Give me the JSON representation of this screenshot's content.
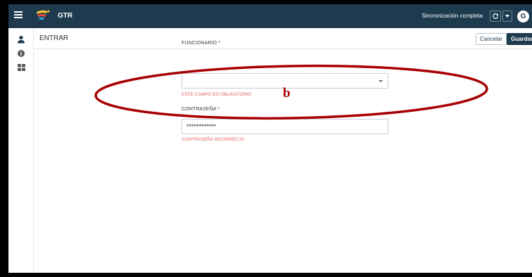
{
  "header": {
    "app_title": "GTR",
    "sync_status": "Sincronización completa",
    "avatar_letter": "G"
  },
  "subheader": {
    "title": "ENTRAR",
    "cancel_label": "Cancelar",
    "save_label": "Guardar"
  },
  "form": {
    "funcionario": {
      "label": "FUNCIONARIO *",
      "value": "",
      "error": "ESTE CAMPO ES OBLIGATORIO"
    },
    "password": {
      "label": "CONTRASEÑA *",
      "value": "************",
      "error": "CONTRASEÑA INCORRECTA"
    }
  },
  "annotation": {
    "letter": "b",
    "color": "#a80000"
  },
  "colors": {
    "topbar": "#1d3a4f",
    "error": "#e35d5d",
    "primary_button": "#1d3a4f"
  },
  "icons": {
    "menu": "menu-icon",
    "logo": "gtr-logo-icon",
    "sync": "sync-icon",
    "dropdown": "chevron-down-icon",
    "user": "user-icon",
    "info": "info-icon",
    "grid": "grid-icon"
  }
}
